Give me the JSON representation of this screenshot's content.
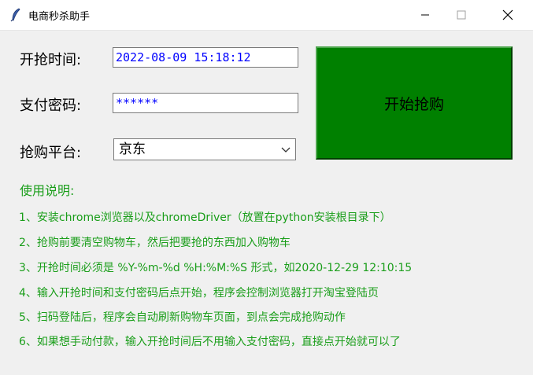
{
  "window": {
    "title": "电商秒杀助手"
  },
  "form": {
    "start_time_label": "开抢时间:",
    "start_time_value": "2022-08-09 15:18:12",
    "password_label": "支付密码:",
    "password_value": "******",
    "platform_label": "抢购平台:",
    "platform_value": "京东"
  },
  "start_button_label": "开始抢购",
  "instructions": {
    "title": "使用说明:",
    "items": [
      "1、安装chrome浏览器以及chromeDriver（放置在python安装根目录下）",
      "2、抢购前要清空购物车，然后把要抢的东西加入购物车",
      "3、开抢时间必须是 %Y-%m-%d %H:%M:%S 形式，如2020-12-29 12:10:15",
      "4、输入开抢时间和支付密码后点开始，程序会控制浏览器打开淘宝登陆页",
      "5、扫码登陆后，程序会自动刷新购物车页面，到点会完成抢购动作",
      "6、如果想手动付款，输入开抢时间后不用输入支付密码，直接点开始就可以了"
    ]
  },
  "colors": {
    "button_bg": "#008000",
    "instruction_text": "#1a9e1a",
    "input_text": "#0000ff"
  },
  "icons": [
    "feather-icon",
    "minimize-icon",
    "maximize-icon",
    "close-icon",
    "chevron-down-icon"
  ]
}
